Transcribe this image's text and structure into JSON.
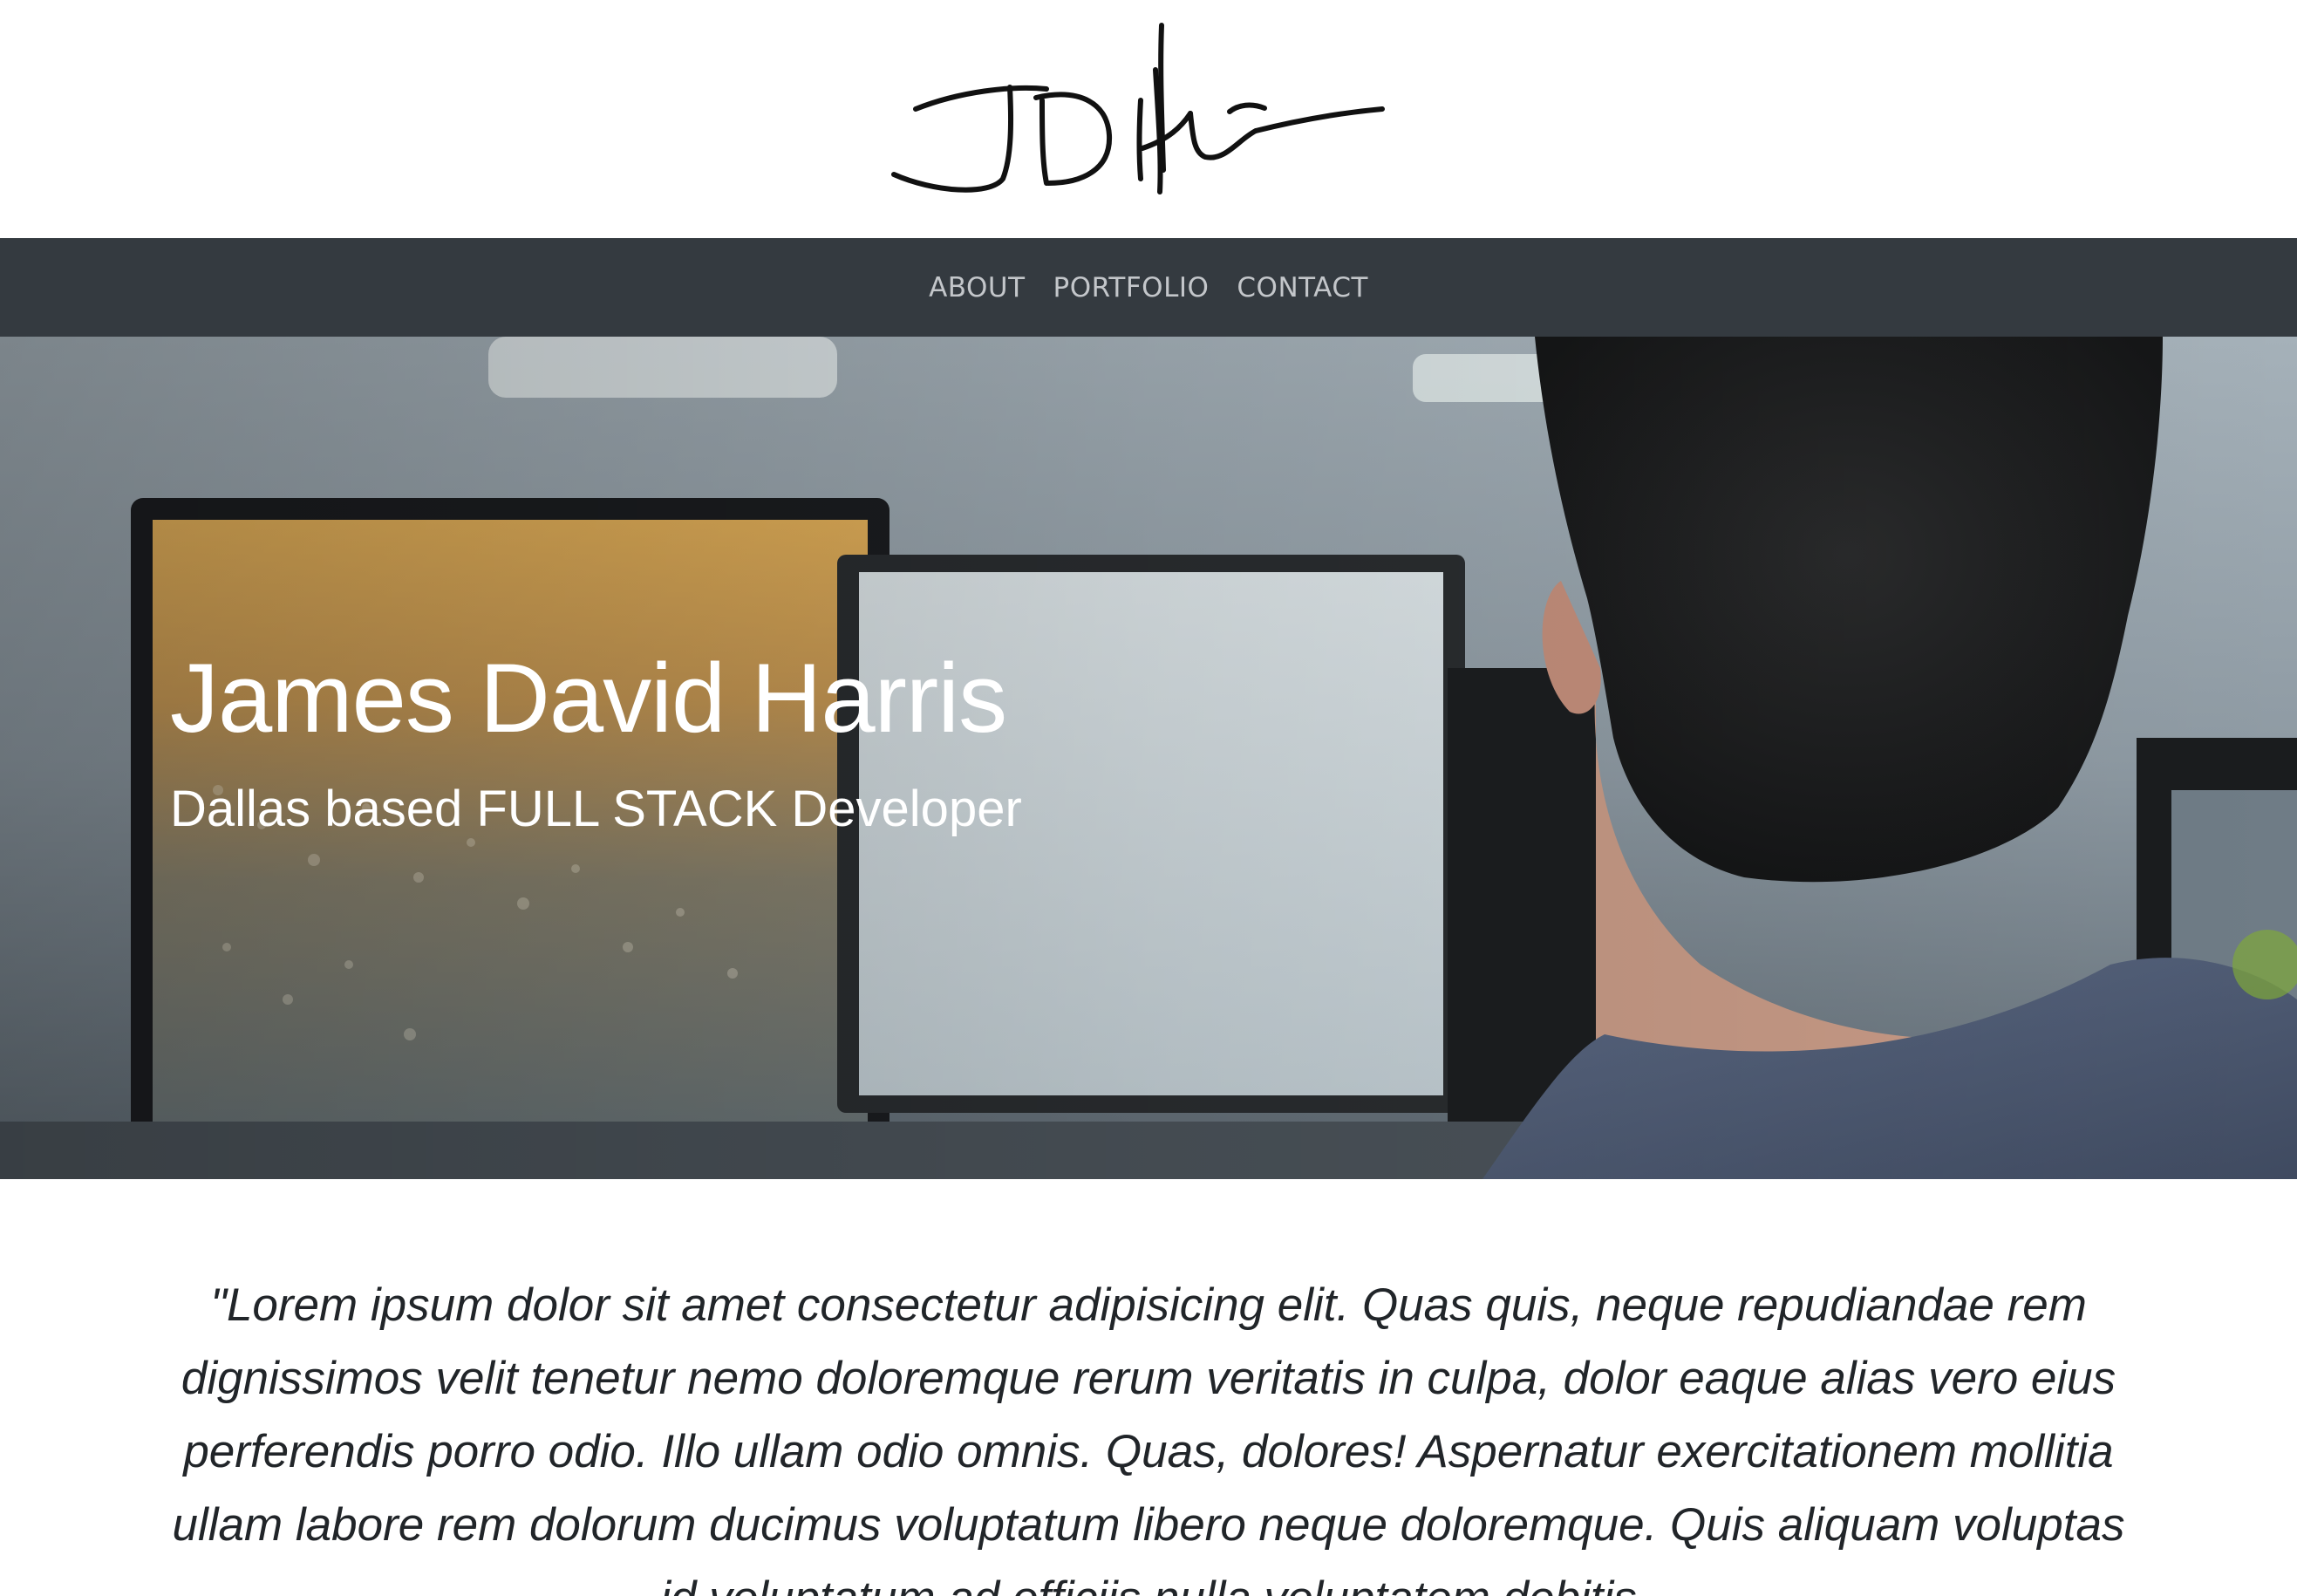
{
  "header": {
    "signature_logo": "JD Harris"
  },
  "nav": {
    "items": [
      {
        "label": "ABOUT"
      },
      {
        "label": "PORTFOLIO"
      },
      {
        "label": "CONTACT"
      }
    ]
  },
  "hero": {
    "title": "James David Harris",
    "subtitle": "Dallas based FULL STACK Developer",
    "background_image": "developer looking at monitor in office"
  },
  "quote": {
    "text": "\"Lorem ipsum dolor sit amet consectetur adipisicing elit. Quas quis, neque repudiandae rem dignissimos velit tenetur nemo doloremque rerum veritatis in culpa, dolor eaque alias vero eius perferendis porro odio. Illo ullam odio omnis. Quas, dolores! Aspernatur exercitationem mollitia ullam labore rem dolorum ducimus voluptatum libero neque doloremque. Quis aliquam voluptas id voluptatum ad officiis nulla voluptatem debitis"
  },
  "colors": {
    "nav_bg": "#343a40",
    "nav_text": "#c3c6ca",
    "hero_text": "#ffffff",
    "body_text": "#212529"
  }
}
